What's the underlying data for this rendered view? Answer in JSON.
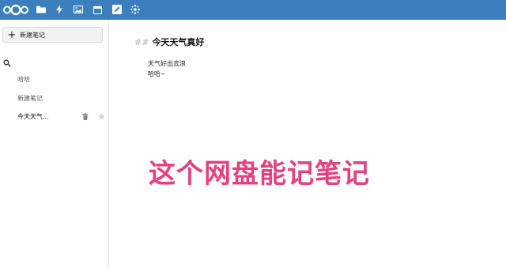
{
  "topbar": {
    "logo_icon": "nextcloud-logo-icon",
    "apps": [
      {
        "name": "files",
        "icon": "folder-icon"
      },
      {
        "name": "activity",
        "icon": "bolt-icon"
      },
      {
        "name": "gallery",
        "icon": "image-icon"
      },
      {
        "name": "calendar",
        "icon": "calendar-icon"
      },
      {
        "name": "notes",
        "icon": "pencil-square-icon",
        "active": true
      },
      {
        "name": "circles",
        "icon": "circles-icon"
      }
    ],
    "background_color": "#3b7fbf"
  },
  "sidebar": {
    "new_note_label": "新建笔记",
    "search_icon": "search-icon",
    "notes": [
      {
        "title": "哈哈"
      },
      {
        "title": "新建笔记"
      },
      {
        "title": "今天天气...",
        "active": true
      }
    ]
  },
  "editor": {
    "heading_mark": "##",
    "title": "今天天气真好",
    "lines": [
      "天气好出去浪",
      "哈哈~"
    ]
  },
  "overlay": {
    "caption": "这个网盘能记笔记",
    "color": "#e83f81"
  }
}
